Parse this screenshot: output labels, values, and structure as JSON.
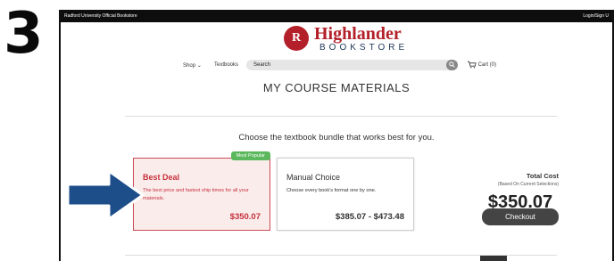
{
  "step": {
    "number": "3"
  },
  "topbar": {
    "left_text": "Radford University Official Bookstore",
    "right_text": "Login/Sign U"
  },
  "logo": {
    "badge_letter": "R",
    "brand": "Highlander",
    "sub": "BOOKSTORE"
  },
  "nav": {
    "shop_label": "Shop",
    "textbooks_label": "Textbooks",
    "search_placeholder": "Search",
    "cart_label": "Cart (0)"
  },
  "page": {
    "title": "MY COURSE MATERIALS",
    "prompt": "Choose the textbook bundle that works best for you."
  },
  "cards": {
    "best": {
      "badge": "Most Popular",
      "title": "Best Deal",
      "desc": "The best price and fastest ship times for all your materials.",
      "price": "$350.07"
    },
    "manual": {
      "title": "Manual Choice",
      "desc": "Choose every book's format one by one.",
      "price": "$385.07 - $473.48"
    }
  },
  "total": {
    "label": "Total Cost",
    "sub": "(Based On Current Selections)",
    "amount": "$350.07",
    "checkout_label": "Checkout"
  },
  "icons": {
    "search": "search-icon",
    "cart": "cart-icon",
    "chevron": "chevron-down-icon",
    "arrow": "arrow-right-icon"
  },
  "colors": {
    "accent_red": "#c5303b",
    "arrow_blue": "#1d4e89",
    "popular_green": "#5cb85c",
    "button_dark": "#444444"
  }
}
